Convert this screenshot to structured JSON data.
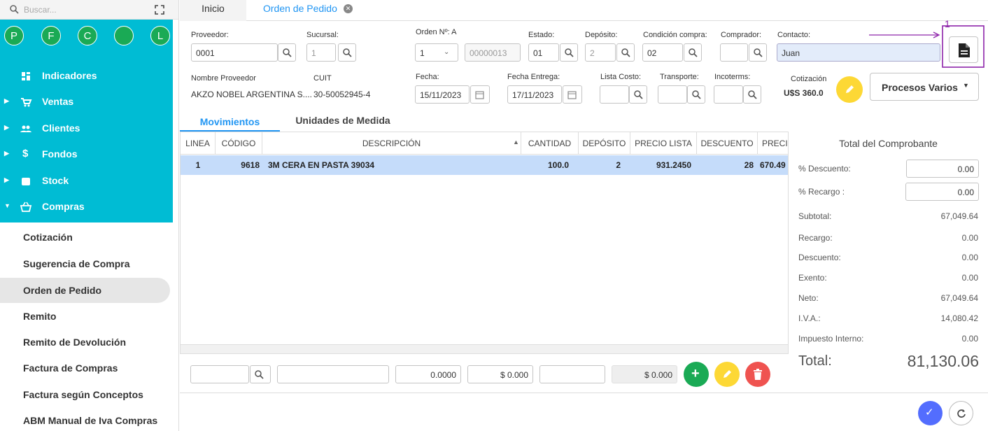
{
  "sidebar": {
    "search_placeholder": "Buscar...",
    "circles": [
      "P",
      "F",
      "C",
      "",
      "L"
    ],
    "nav": [
      {
        "label": "Indicadores",
        "icon": "dashboard-icon"
      },
      {
        "label": "Ventas",
        "icon": "cart-icon"
      },
      {
        "label": "Clientes",
        "icon": "people-icon"
      },
      {
        "label": "Fondos",
        "icon": "dollar-icon"
      },
      {
        "label": "Stock",
        "icon": "box-icon"
      },
      {
        "label": "Compras",
        "icon": "basket-icon"
      }
    ],
    "sub": [
      "Cotización",
      "Sugerencia de Compra",
      "Orden de Pedido",
      "Remito",
      "Remito de Devolución",
      "Factura de Compras",
      "Factura según Conceptos",
      "ABM Manual de Iva Compras"
    ]
  },
  "tabs": {
    "home": "Inicio",
    "active": "Orden de Pedido"
  },
  "form": {
    "proveedor_label": "Proveedor:",
    "proveedor_value": "0001",
    "sucursal_label": "Sucursal:",
    "sucursal_value": "1",
    "orden_label": "Orden Nº: A",
    "orden_select": "1",
    "orden_num": "00000013",
    "estado_label": "Estado:",
    "estado_value": "01",
    "deposito_label": "Depósito:",
    "deposito_value": "2",
    "condicion_label": "Condición compra:",
    "condicion_value": "02",
    "comprador_label": "Comprador:",
    "comprador_value": "",
    "contacto_label": "Contacto:",
    "contacto_value": "Juan",
    "nombre_label": "Nombre Proveedor",
    "nombre_value": "AKZO NOBEL ARGENTINA S....",
    "cuit_label": "CUIT",
    "cuit_value": "30-50052945-4",
    "fecha_label": "Fecha:",
    "fecha_value": "15/11/2023",
    "fecha_entrega_label": "Fecha Entrega:",
    "fecha_entrega_value": "17/11/2023",
    "lista_costo_label": "Lista Costo:",
    "transporte_label": "Transporte:",
    "incoterms_label": "Incoterms:",
    "cotizacion_label": "Cotización",
    "cotizacion_value": "U$S  360.0",
    "procesos_label": "Procesos Varios",
    "annotation": "1"
  },
  "subtabs": [
    "Movimientos",
    "Unidades de Medida"
  ],
  "table": {
    "columns": [
      "LINEA",
      "CÓDIGO",
      "DESCRIPCIÓN",
      "CANTIDAD",
      "DEPÓSITO",
      "PRECIO LISTA",
      "DESCUENTO",
      "PRECI"
    ],
    "rows": [
      {
        "linea": "1",
        "codigo": "9618",
        "descripcion": "3M CERA EN PASTA 39034",
        "cantidad": "100.0",
        "deposito": "2",
        "precio_lista": "931.2450",
        "descuento": "28",
        "precio": "670.49"
      }
    ]
  },
  "entry": {
    "qty": "0.0000",
    "price": "$ 0.000",
    "total": "$ 0.000"
  },
  "totals": {
    "title": "Total del Comprobante",
    "descuento_label": "% Descuento:",
    "descuento_value": "0.00",
    "recargo_label": "% Recargo :",
    "recargo_value": "0.00",
    "lines": [
      {
        "label": "Subtotal:",
        "value": "67,049.64"
      },
      {
        "label": "Recargo:",
        "value": "0.00"
      },
      {
        "label": "Descuento:",
        "value": "0.00"
      },
      {
        "label": "Exento:",
        "value": "0.00"
      },
      {
        "label": "Neto:",
        "value": "67,049.64"
      },
      {
        "label": "I.V.A.:",
        "value": "14,080.42"
      },
      {
        "label": "Impuesto Interno:",
        "value": "0.00"
      }
    ],
    "total_label": "Total:",
    "total_value": "81,130.06"
  },
  "colors": {
    "teal": "#00bcd4",
    "accent": "#2196f3",
    "green": "#1aaa55",
    "yellow": "#fdd835",
    "red": "#ef5350",
    "purple": "#8e24aa",
    "blue_btn": "#536dfe"
  }
}
